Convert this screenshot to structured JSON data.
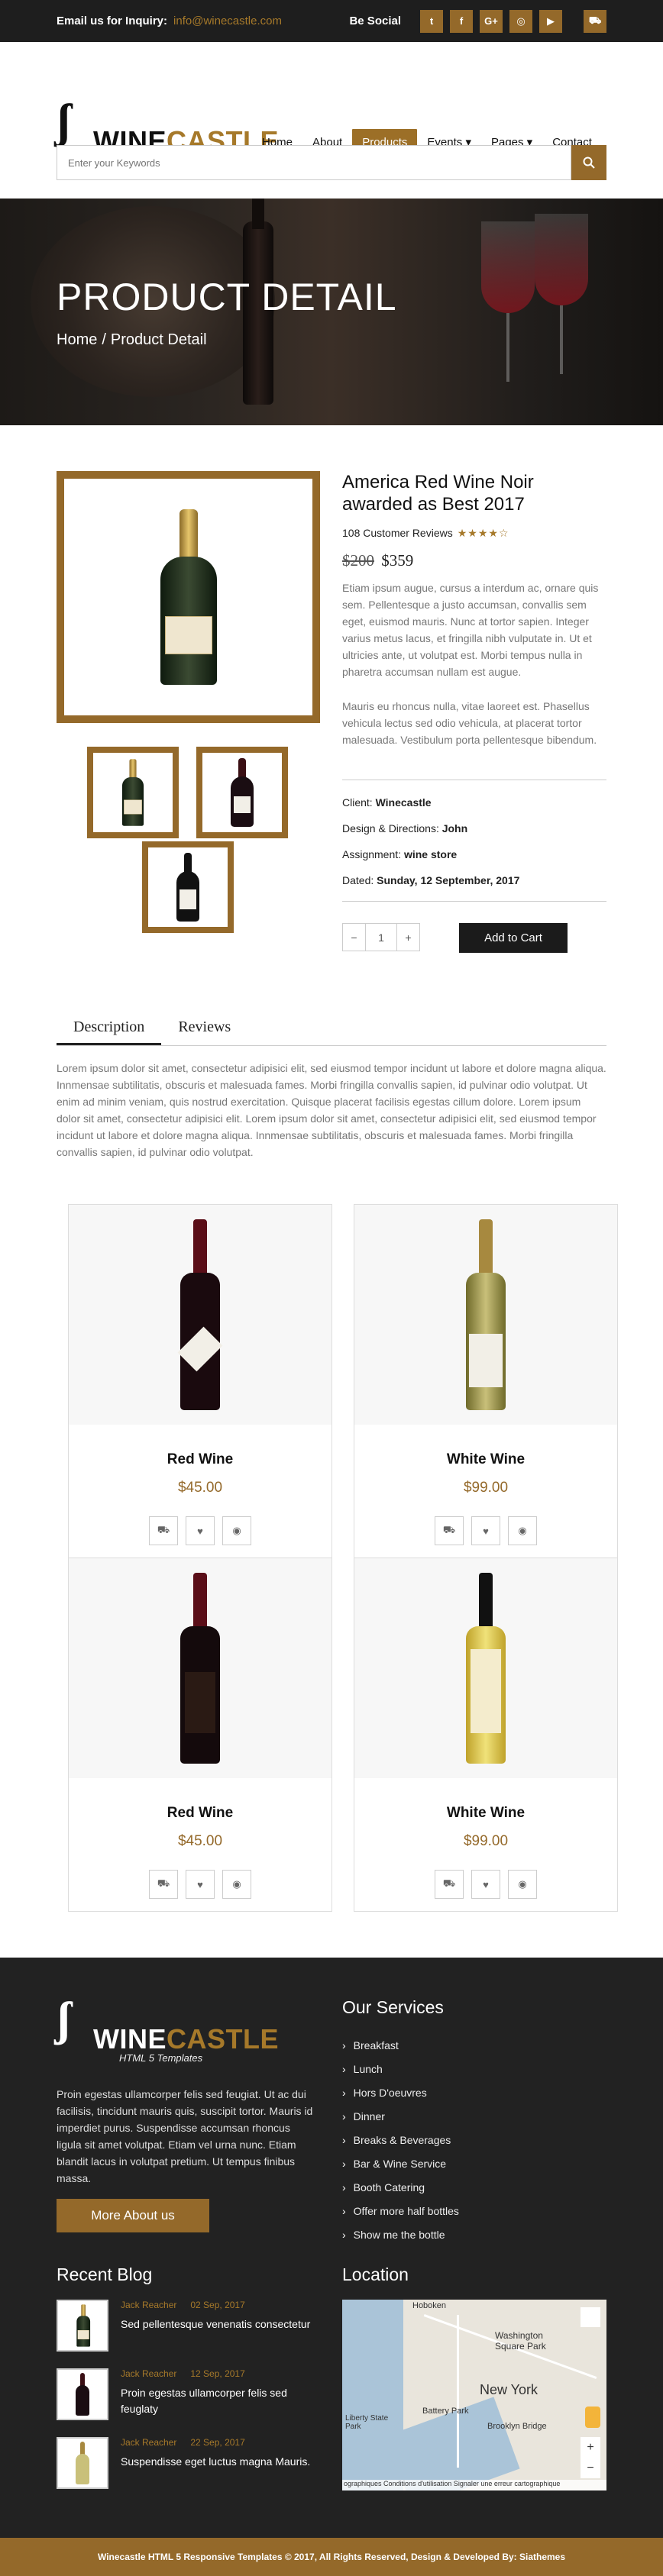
{
  "topbar": {
    "inquiry_label": "Email us for Inquiry:",
    "email": "info@winecastle.com",
    "social_label": "Be Social",
    "social_icons": [
      "twitter-icon",
      "facebook-icon",
      "google-plus-icon",
      "instagram-icon",
      "youtube-icon"
    ],
    "cart_icon": "cart-icon"
  },
  "brand": {
    "name_part1": "WINE",
    "name_part2": "CASTLE",
    "tagline": "HTML 5 Templates",
    "accent": "#94692a"
  },
  "nav": {
    "items": [
      "Home",
      "About",
      "Products",
      "Events ▾",
      "Pages ▾",
      "Contact"
    ],
    "active": "Products"
  },
  "search": {
    "placeholder": "Enter your Keywords"
  },
  "hero": {
    "title": "PRODUCT DETAIL",
    "breadcrumb": [
      "Home",
      "/",
      "Product Detail"
    ]
  },
  "product": {
    "title": "America Red Wine Noir awarded as Best 2017",
    "reviews": "108 Customer Reviews",
    "rating": 4,
    "stars": "★★★★☆",
    "old_price": "$200",
    "price": "$359",
    "description1": "Etiam ipsum augue, cursus a interdum ac, ornare quis sem. Pellentesque a justo accumsan, convallis sem eget, euismod mauris. Nunc at tortor sapien. Integer varius metus lacus, et fringilla nibh vulputate in. Ut et ultricies ante, ut volutpat est. Morbi tempus nulla in pharetra accumsan nullam est augue.",
    "description2": "Mauris eu rhoncus nulla, vitae laoreet est. Phasellus vehicula lectus sed odio vehicula, at placerat tortor malesuada. Vestibulum porta pellentesque bibendum.",
    "meta": [
      {
        "label": "Client:",
        "value": "Winecastle"
      },
      {
        "label": "Design & Directions:",
        "value": "John"
      },
      {
        "label": "Assignment:",
        "value": "wine store"
      },
      {
        "label": "Dated:",
        "value": "Sunday, 12 September, 2017"
      }
    ],
    "qty": {
      "minus": "−",
      "value": "1",
      "plus": "+"
    },
    "add_to_cart": "Add to Cart"
  },
  "tabs": {
    "items": [
      "Description",
      "Reviews"
    ],
    "active": "Description",
    "text": "Lorem ipsum dolor sit amet, consectetur adipisici elit, sed eiusmod tempor incidunt ut labore et dolore magna aliqua. Innmensae subtilitatis, obscuris et malesuada fames. Morbi fringilla convallis sapien, id pulvinar odio volutpat. Ut enim ad minim veniam, quis nostrud exercitation. Quisque placerat facilisis egestas cillum dolore. Lorem ipsum dolor sit amet, consectetur adipisici elit. Lorem ipsum dolor sit amet, consectetur adipisici elit, sed eiusmod tempor incidunt ut labore et dolore magna aliqua. Innmensae subtilitatis, obscuris et malesuada fames. Morbi fringilla convallis sapien, id pulvinar odio volutpat."
  },
  "related": [
    {
      "name": "Red Wine",
      "price": "$45.00"
    },
    {
      "name": "White Wine",
      "price": "$99.00"
    },
    {
      "name": "Red Wine",
      "price": "$45.00"
    },
    {
      "name": "White Wine",
      "price": "$99.00"
    }
  ],
  "card_actions": [
    "cart-icon",
    "heart-icon",
    "eye-icon"
  ],
  "footer": {
    "about": "Proin egestas ullamcorper felis sed feugiat. Ut ac dui facilisis, tincidunt mauris quis, suscipit tortor. Mauris id imperdiet purus. Suspendisse accumsan rhoncus ligula sit amet volutpat. Etiam vel urna nunc. Etiam blandit lacus in volutpat pretium. Ut tempus finibus massa.",
    "more_button": "More About us",
    "services_title": "Our Services",
    "services": [
      "Breakfast",
      "Lunch",
      "Hors D'oeuvres",
      "Dinner",
      "Breaks & Beverages",
      "Bar & Wine Service",
      "Booth Catering",
      "Offer more half bottles",
      "Show me the bottle"
    ],
    "blog_title": "Recent Blog",
    "blog": [
      {
        "author": "Jack Reacher",
        "date": "02 Sep, 2017",
        "title": "Sed pellentesque venenatis consectetur"
      },
      {
        "author": "Jack Reacher",
        "date": "12 Sep, 2017",
        "title": "Proin egestas ullamcorper felis sed feuglaty"
      },
      {
        "author": "Jack Reacher",
        "date": "22 Sep, 2017",
        "title": "Suspendisse eget luctus magna Mauris."
      }
    ],
    "location_title": "Location",
    "map": {
      "labels": [
        "Hoboken",
        "Washington Square Park",
        "New York",
        "Battery Park",
        "Brooklyn Bridge",
        "Liberty State Park"
      ],
      "credits": "ographiques   Conditions d'utilisation   Signaler une erreur cartographique",
      "zoom_in": "+",
      "zoom_out": "−"
    },
    "copyright": "Winecastle HTML 5 Responsive Templates © 2017, All Rights Reserved, Design & Developed By: Siathemes"
  }
}
